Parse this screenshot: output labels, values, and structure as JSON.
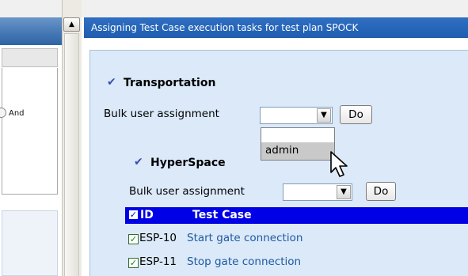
{
  "header": {
    "title": "Assigning Test Case execution tasks for test plan SPOCK"
  },
  "left_panel": {
    "and_label": "And"
  },
  "transportation": {
    "title": "Transportation",
    "bulk_label": "Bulk user assignment",
    "select_value": "",
    "do_label": "Do",
    "dropdown_options": [
      "",
      "admin"
    ],
    "dropdown_highlighted": "admin"
  },
  "hyperspace": {
    "title": "HyperSpace",
    "bulk_label": "Bulk user assignment",
    "select_value": "",
    "do_label": "Do",
    "table": {
      "columns": [
        "ID",
        "Test Case"
      ],
      "rows": [
        {
          "id": "ESP-10",
          "title": "Start gate connection",
          "checked": true
        },
        {
          "id": "ESP-11",
          "title": "Stop gate connection",
          "checked": true
        }
      ]
    }
  },
  "icons": {
    "checkmark": "checkmark-icon",
    "cursor": "mouse-pointer-icon",
    "scroll_up": "scroll-up-arrow-icon",
    "select_arrow": "chevron-down-icon"
  },
  "colors": {
    "header_bg": "#1f5db0",
    "table_header_bg": "#0000e6",
    "frame_bg": "#dbe9f9",
    "link": "#1e5aa0"
  }
}
